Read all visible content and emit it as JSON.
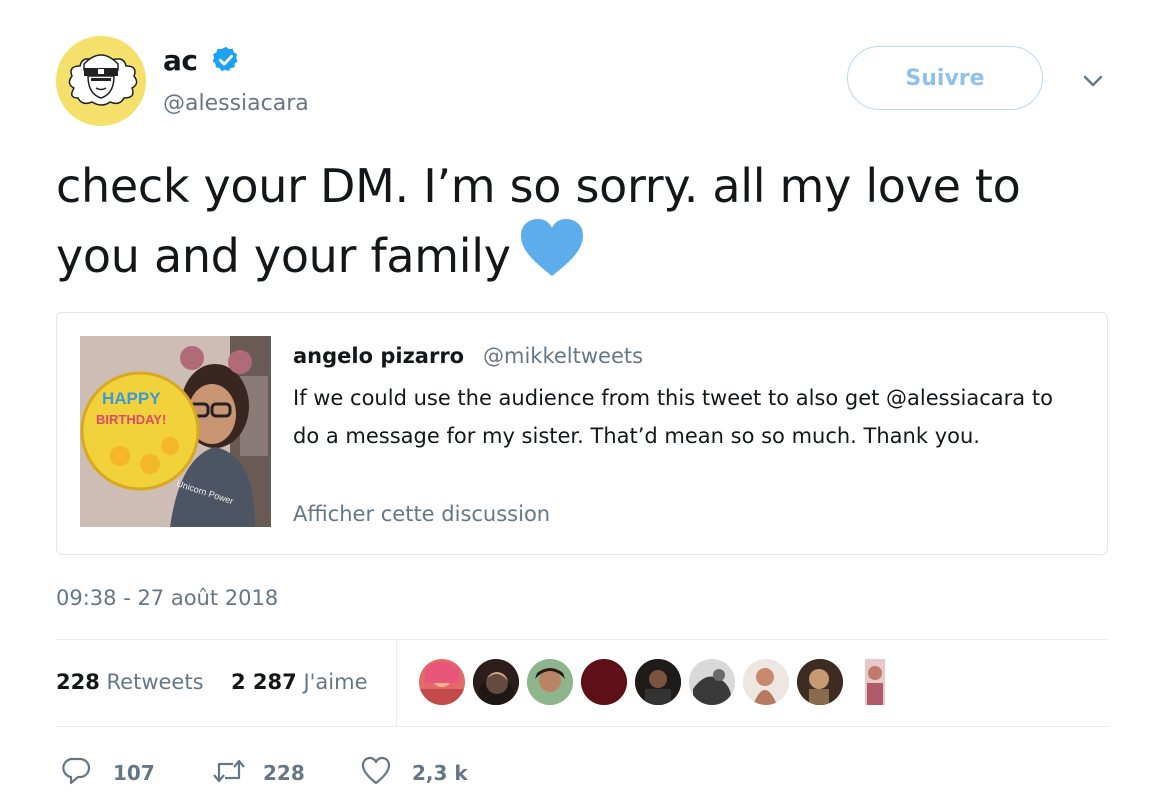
{
  "author": {
    "name": "ac",
    "handle": "@alessiacara",
    "verified": true
  },
  "follow_button": {
    "label": "Suivre"
  },
  "tweet": {
    "text": "check your DM. I’m so sorry. all my love to you and your family"
  },
  "quoted_tweet": {
    "name": "angelo pizarro",
    "handle": "@mikkeltweets",
    "text": "If we could use the audience from this tweet to also get @alessiacara to do a message for my sister. That’d mean so so much. Thank you.",
    "link": "Afficher cette discussion",
    "image_text": [
      "HAPPY",
      "BIRTHDAY!",
      "Unicorn Power"
    ]
  },
  "timestamp": "09:38 - 27 août 2018",
  "stats": {
    "retweets_count": "228",
    "retweets_label": "Retweets",
    "likes_count": "2 287",
    "likes_label": "J'aime"
  },
  "actions": {
    "reply_count": "107",
    "retweet_count": "228",
    "like_count": "2,3 k"
  },
  "colors": {
    "accent": "#1da1f2",
    "follow_text": "#8ec1ec",
    "secondary_text": "#657786",
    "heart_emoji": "#5dadec",
    "avatar_bg": "#f4e06a"
  }
}
